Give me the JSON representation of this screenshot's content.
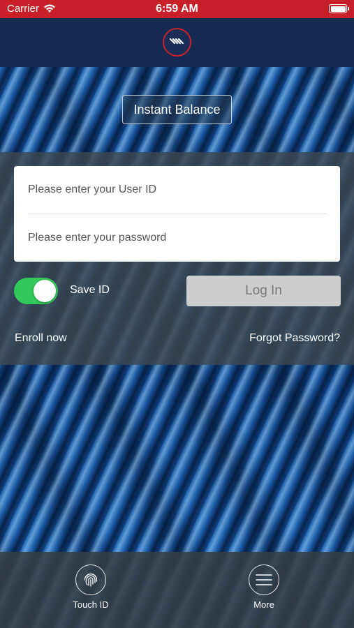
{
  "status_bar": {
    "carrier": "Carrier",
    "time": "6:59 AM",
    "color": "#c8202b"
  },
  "nav_bar": {
    "logo_icon": "bank-logo-icon",
    "color": "#172a52"
  },
  "hero": {
    "instant_balance_label": "Instant Balance"
  },
  "login_form": {
    "user_id": {
      "value": "",
      "placeholder": "Please enter your User ID"
    },
    "password": {
      "value": "",
      "placeholder": "Please enter your password"
    },
    "save_id": {
      "label": "Save ID",
      "checked": true,
      "color": "#34c759"
    },
    "login_button": {
      "label": "Log In",
      "enabled": false
    },
    "enroll_link": "Enroll now",
    "forgot_link": "Forgot Password?"
  },
  "tab_bar": {
    "items": [
      {
        "label": "Touch ID",
        "icon": "fingerprint-icon"
      },
      {
        "label": "More",
        "icon": "hamburger-menu-icon"
      }
    ]
  }
}
